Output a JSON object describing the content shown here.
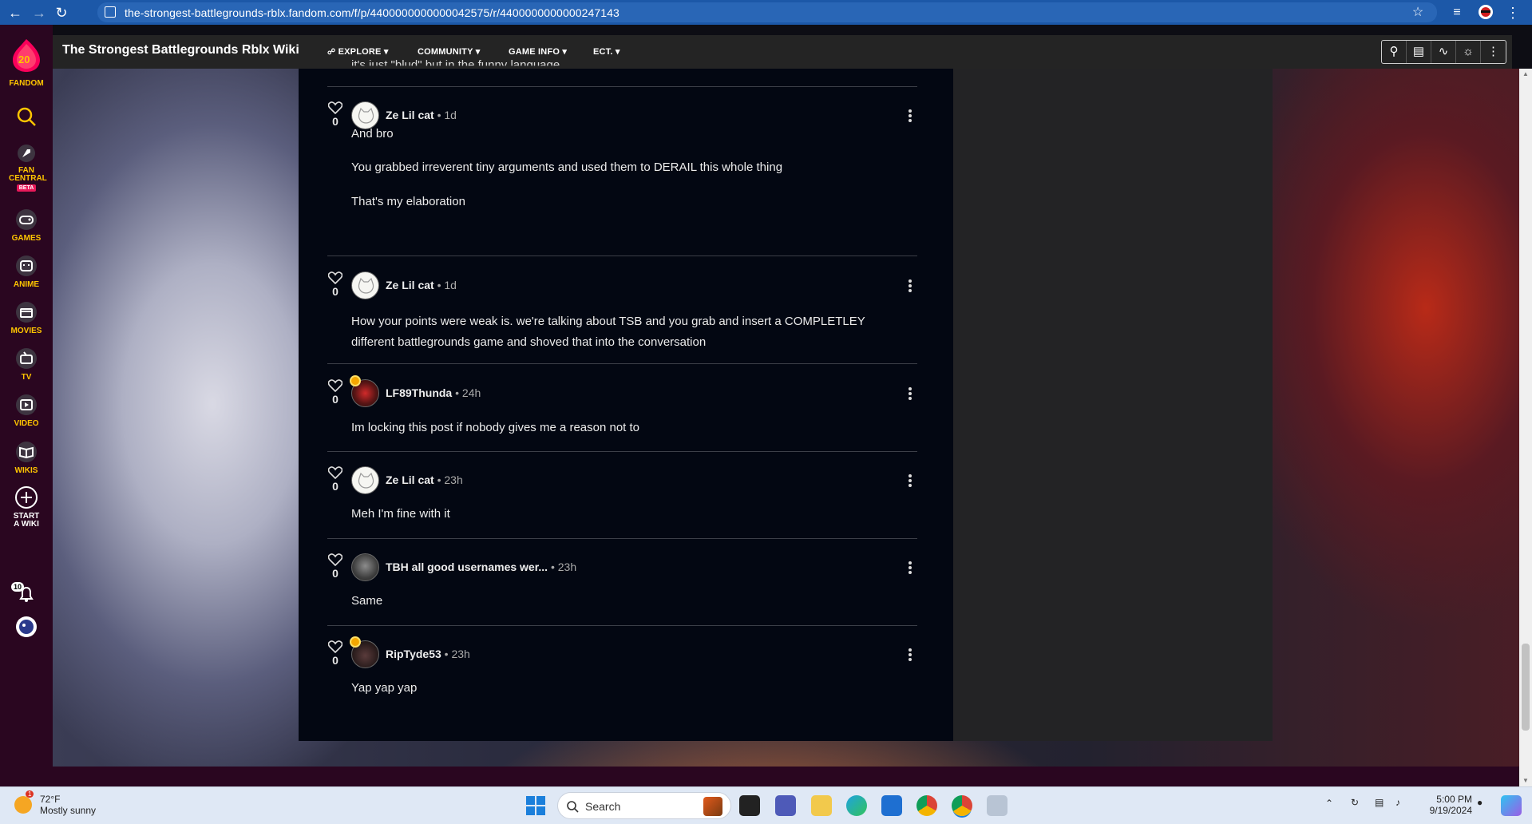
{
  "browser": {
    "url": "the-strongest-battlegrounds-rblx.fandom.com/f/p/4400000000000042575/r/4400000000000247143"
  },
  "rail": {
    "fandom_label": "FANDOM",
    "logo_number": "20",
    "items": [
      {
        "label": "FAN CENTRAL",
        "badge": "BETA"
      },
      {
        "label": "GAMES"
      },
      {
        "label": "ANIME"
      },
      {
        "label": "MOVIES"
      },
      {
        "label": "TV"
      },
      {
        "label": "VIDEO"
      },
      {
        "label": "WIKIS"
      },
      {
        "label": "START A WIKI"
      }
    ],
    "notification_count": "10"
  },
  "wiki": {
    "title": "The Strongest Battlegrounds Rblx Wiki",
    "nav": [
      "EXPLORE",
      "COMMUNITY",
      "GAME INFO",
      "ECT."
    ]
  },
  "thread": {
    "cut_off_text": "it's just \"blud\" but in the funny language",
    "comments": [
      {
        "author": "Ze Lil cat",
        "time": "1d",
        "likes": "0",
        "avatar": "cat",
        "badge": false,
        "lines": [
          "And bro",
          "You grabbed irreverent tiny arguments and used them to DERAIL this whole thing",
          "That's my elaboration"
        ]
      },
      {
        "author": "Ze Lil cat",
        "time": "1d",
        "likes": "0",
        "avatar": "cat",
        "badge": false,
        "lines": [
          "How your points were weak is. we're talking about TSB and you grab and insert a COMPLETLEY",
          "different battlegrounds game and shoved that into the conversation"
        ]
      },
      {
        "author": "LF89Thunda",
        "time": "24h",
        "likes": "0",
        "avatar": "red",
        "badge": true,
        "lines": [
          "Im locking this post if nobody gives me a reason not to"
        ]
      },
      {
        "author": "Ze Lil cat",
        "time": "23h",
        "likes": "0",
        "avatar": "cat",
        "badge": false,
        "lines": [
          "Meh I'm fine with it"
        ]
      },
      {
        "author": "TBH all good usernames wer...",
        "time": "23h",
        "likes": "0",
        "avatar": "gray",
        "badge": false,
        "lines": [
          "Same"
        ]
      },
      {
        "author": "RipTyde53",
        "time": "23h",
        "likes": "0",
        "avatar": "dark",
        "badge": true,
        "lines": [
          "Yap yap yap"
        ]
      }
    ]
  },
  "taskbar": {
    "weather_temp": "72°F",
    "weather_desc": "Mostly sunny",
    "weather_alert": "1",
    "search_placeholder": "Search",
    "time": "5:00 PM",
    "date": "9/19/2024"
  },
  "colors": {
    "fandom_rail": "#2a0620",
    "fandom_accent": "#ffc500",
    "content_bg": "#030712",
    "browser_blue": "#1c58a8"
  }
}
